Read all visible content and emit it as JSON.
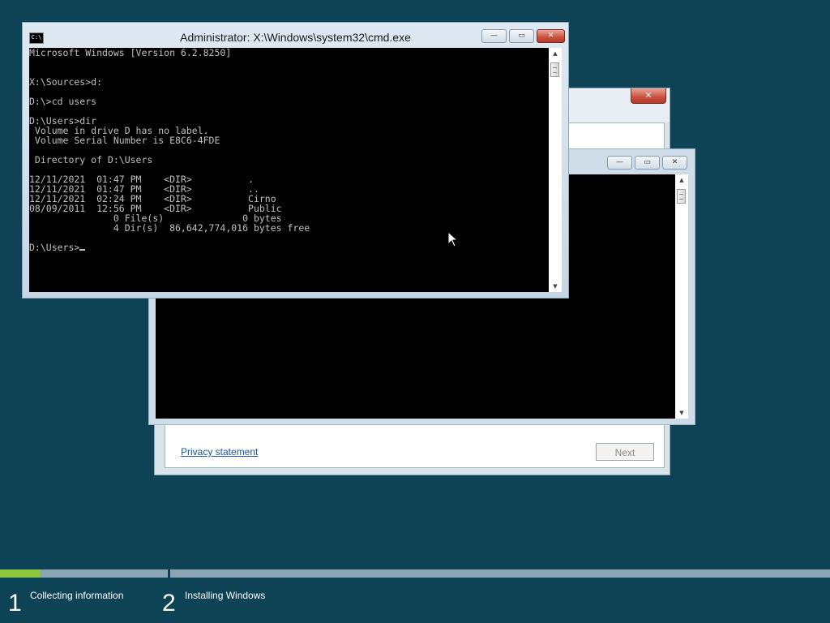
{
  "cmd": {
    "title": "Administrator: X:\\Windows\\system32\\cmd.exe",
    "icon_label": "C:\\",
    "lines": [
      "Microsoft Windows [Version 6.2.8250]",
      "",
      "",
      "X:\\Sources>d:",
      "",
      "D:\\>cd users",
      "",
      "D:\\Users>dir",
      " Volume in drive D has no label.",
      " Volume Serial Number is E8C6-4FDE",
      "",
      " Directory of D:\\Users",
      "",
      "12/11/2021  01:47 PM    <DIR>          .",
      "12/11/2021  01:47 PM    <DIR>          ..",
      "12/11/2021  02:24 PM    <DIR>          Cirno",
      "08/09/2011  12:56 PM    <DIR>          Public",
      "               0 File(s)              0 bytes",
      "               4 Dir(s)  86,642,774,016 bytes free",
      ""
    ],
    "prompt": "D:\\Users>",
    "controls": {
      "minimize": "—",
      "maximize": "▭",
      "close": "✕"
    }
  },
  "cmd_background": {
    "controls": {
      "minimize": "—",
      "maximize": "▭",
      "close": "✕"
    }
  },
  "setup": {
    "privacy_link": "Privacy statement",
    "next_button": "Next",
    "close": "✕"
  },
  "progress": {
    "step1_fraction": 0.24,
    "fill_color": "#8cc63f",
    "track_color": "#8ba5b4"
  },
  "steps": [
    {
      "number": "1",
      "label": "Collecting information"
    },
    {
      "number": "2",
      "label": "Installing Windows"
    }
  ],
  "colors": {
    "desktop": "#0e4356",
    "console_bg": "#000000",
    "console_text": "#c0c0c0"
  }
}
